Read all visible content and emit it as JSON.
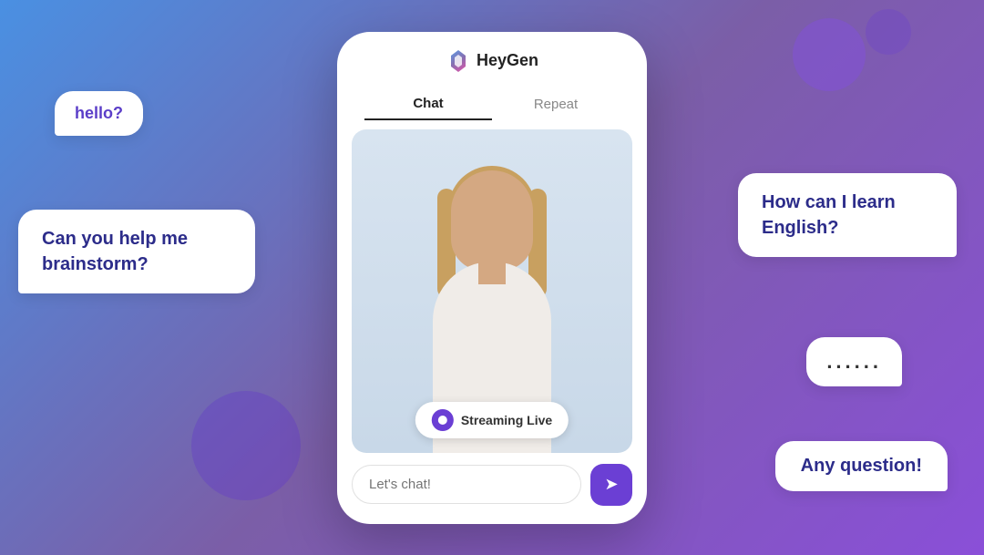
{
  "app": {
    "name": "HeyGen"
  },
  "background": {
    "gradient_start": "#4a90e2",
    "gradient_end": "#8a4fd8"
  },
  "bubbles": {
    "left_1": "hello?",
    "left_2": "Can you help me brainstorm?",
    "right_1": "How can I learn English?",
    "right_2": "......",
    "right_3": "Any question!"
  },
  "phone": {
    "tabs": [
      {
        "label": "Chat",
        "active": true
      },
      {
        "label": "Repeat",
        "active": false
      }
    ],
    "streaming_badge": "Streaming Live",
    "input_placeholder": "Let's chat!",
    "send_button_label": "Send"
  }
}
